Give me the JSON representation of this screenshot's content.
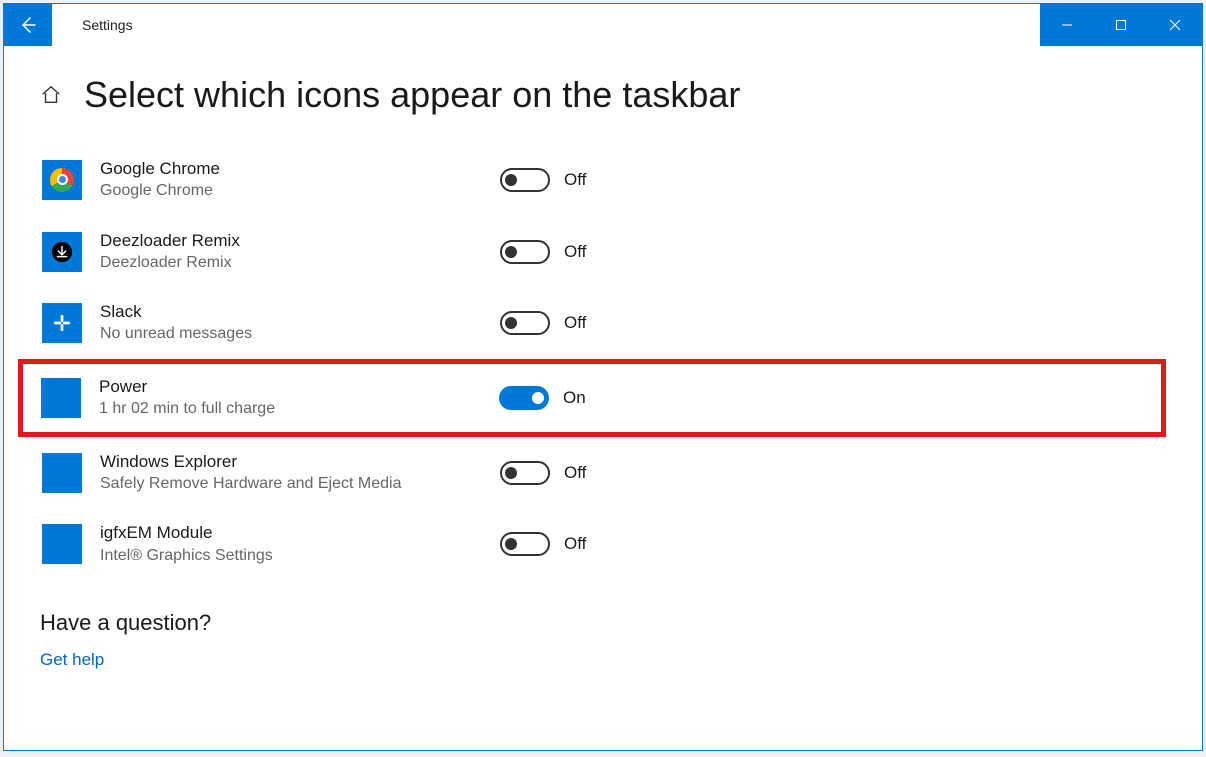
{
  "window": {
    "title": "Settings"
  },
  "heading": "Select which icons appear on the taskbar",
  "toggle_labels": {
    "on": "On",
    "off": "Off"
  },
  "items": [
    {
      "name": "Google Chrome",
      "sub": "Google Chrome",
      "on": false
    },
    {
      "name": "Deezloader Remix",
      "sub": "Deezloader Remix",
      "on": false
    },
    {
      "name": "Slack",
      "sub": "No unread messages",
      "on": false
    },
    {
      "name": "Power",
      "sub": "1 hr 02 min to full charge",
      "on": true
    },
    {
      "name": "Windows Explorer",
      "sub": "Safely Remove Hardware and Eject Media",
      "on": false
    },
    {
      "name": "igfxEM Module",
      "sub": "Intel® Graphics Settings",
      "on": false
    }
  ],
  "help": {
    "question": "Have a question?",
    "link": "Get help"
  }
}
